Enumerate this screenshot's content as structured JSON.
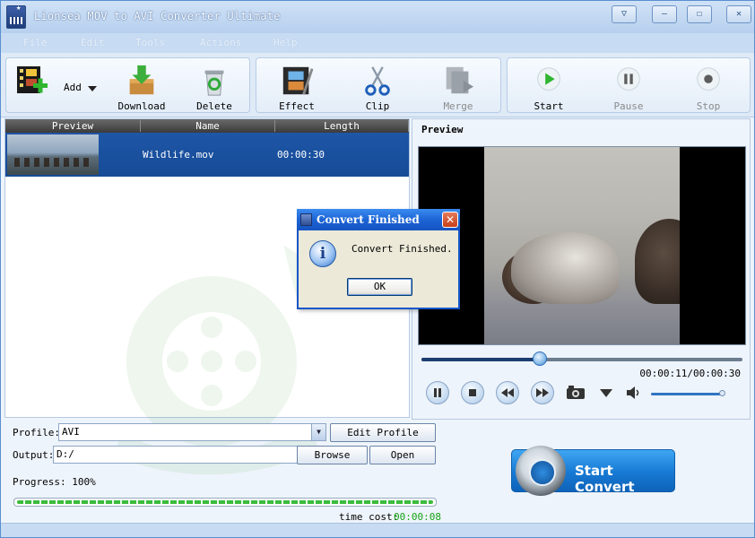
{
  "window": {
    "title": "Lionsea MOV to AVI Converter Ultimate",
    "controls": [
      "▽",
      "—",
      "☐",
      "✕"
    ]
  },
  "menu": [
    "File",
    "Edit",
    "Tools",
    "Actions",
    "Help"
  ],
  "toolbar": {
    "add": "Add",
    "download": "Download",
    "delete": "Delete",
    "effect": "Effect",
    "clip": "Clip",
    "merge": "Merge",
    "start": "Start",
    "pause": "Pause",
    "stop": "Stop"
  },
  "file_list": {
    "columns": [
      "Preview",
      "Name",
      "Length"
    ],
    "rows": [
      {
        "name": "Wildlife.mov",
        "length": "00:00:30"
      }
    ]
  },
  "preview": {
    "title": "Preview",
    "time": "00:00:11/00:00:30",
    "progress": 0.37,
    "volume": 1.0
  },
  "bottom": {
    "profile_label": "Profile:",
    "profile_value": "AVI",
    "edit_profile": "Edit Profile",
    "output_label": "Output:",
    "output_value": "D:/",
    "browse": "Browse",
    "open": "Open",
    "progress_label": "Progress: 100%",
    "progress_value": 1.0,
    "time_cost_label": "time cost:",
    "time_cost_value": "00:00:08",
    "start_convert": "Start Convert"
  },
  "dialog": {
    "title": "Convert Finished",
    "message": "Convert Finished.",
    "ok": "OK"
  },
  "colors": {
    "selection": "#1e56a6",
    "accent": "#1779d3",
    "progress": "#3bbb3b",
    "time_cost": "#17a317"
  }
}
